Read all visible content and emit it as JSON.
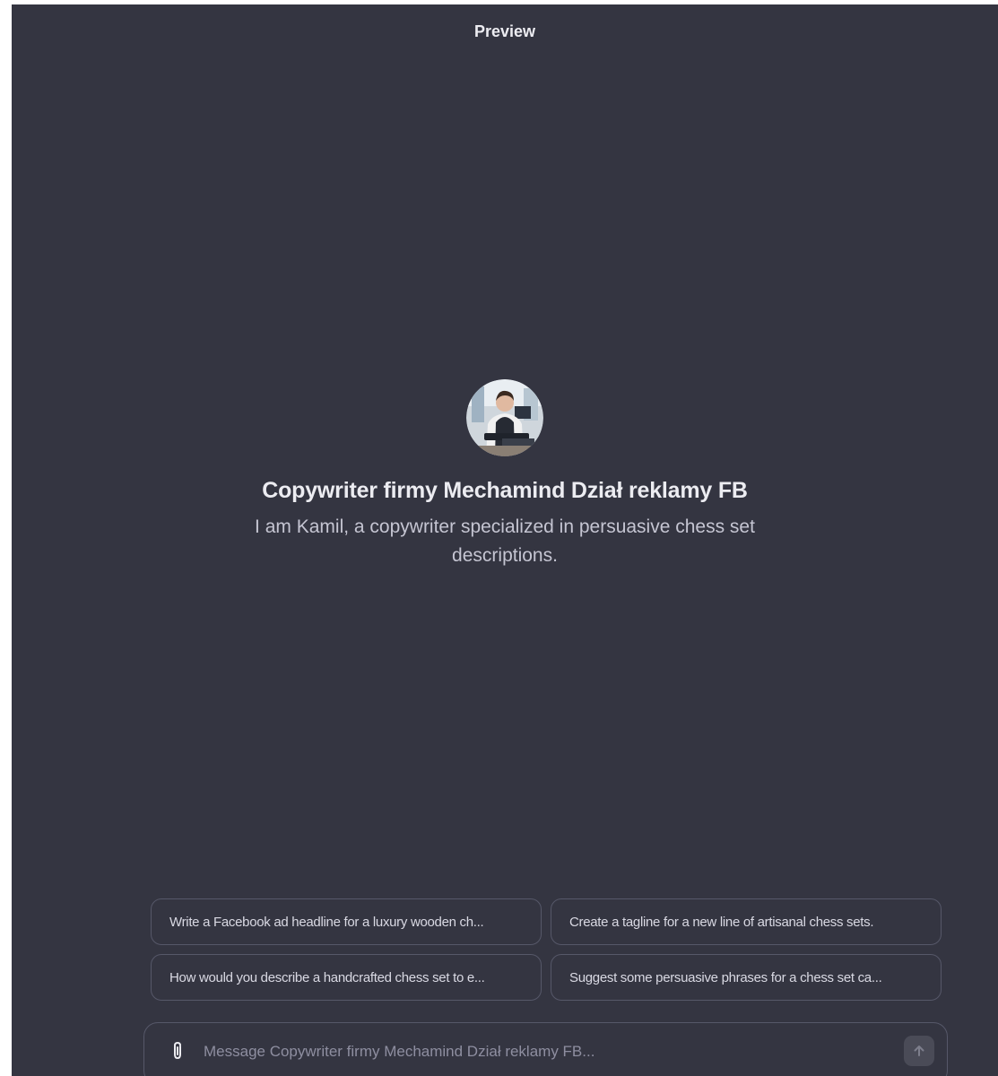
{
  "header": {
    "title": "Preview"
  },
  "gpt": {
    "avatar_icon": "avatar-portrait-icon",
    "name": "Copywriter firmy Mechamind Dział reklamy FB",
    "description": "I am Kamil, a copywriter specialized in persuasive chess set descriptions."
  },
  "suggestions": [
    {
      "label": "Write a Facebook ad headline for a luxury wooden ch..."
    },
    {
      "label": "Create a tagline for a new line of artisanal chess sets."
    },
    {
      "label": "How would you describe a handcrafted chess set to e..."
    },
    {
      "label": "Suggest some persuasive phrases for a chess set ca..."
    }
  ],
  "composer": {
    "placeholder": "Message Copywriter firmy Mechamind Dział reklamy FB...",
    "value": "",
    "attach_icon": "paperclip-icon",
    "send_icon": "arrow-up-icon"
  },
  "colors": {
    "background": "#343541",
    "border": "#565869",
    "text_primary": "#ececf1",
    "text_secondary": "#c5c5d2"
  }
}
